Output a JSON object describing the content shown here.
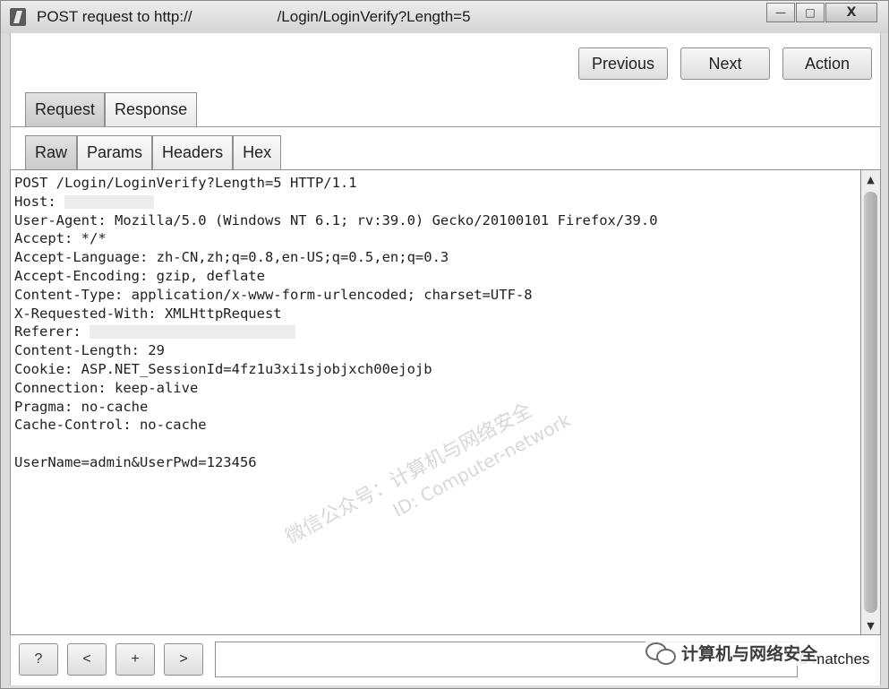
{
  "window": {
    "title_prefix": "POST request to http://",
    "title_path": "/Login/LoginVerify?Length=5",
    "minimize_glyph": "—",
    "maximize_glyph": "□",
    "close_glyph": "X"
  },
  "toolbar": {
    "previous_label": "Previous",
    "next_label": "Next",
    "action_label": "Action"
  },
  "tabs": {
    "request_label": "Request",
    "response_label": "Response"
  },
  "subtabs": {
    "raw_label": "Raw",
    "params_label": "Params",
    "headers_label": "Headers",
    "hex_label": "Hex"
  },
  "request": {
    "line1": "POST /Login/LoginVerify?Length=5 HTTP/1.1",
    "line2": "Host: ",
    "line3": "User-Agent: Mozilla/5.0 (Windows NT 6.1; rv:39.0) Gecko/20100101 Firefox/39.0",
    "line4": "Accept: */*",
    "line5": "Accept-Language: zh-CN,zh;q=0.8,en-US;q=0.5,en;q=0.3",
    "line6": "Accept-Encoding: gzip, deflate",
    "line7": "Content-Type: application/x-www-form-urlencoded; charset=UTF-8",
    "line8": "X-Requested-With: XMLHttpRequest",
    "line9": "Referer: ",
    "line10": "Content-Length: 29",
    "line11": "Cookie: ASP.NET_SessionId=4fz1u3xi1sjobjxch00ejojb",
    "line12": "Connection: keep-alive",
    "line13": "Pragma: no-cache",
    "line14": "Cache-Control: no-cache",
    "line15": "",
    "line16": "UserName=admin&UserPwd=123456"
  },
  "bottom": {
    "help_label": "?",
    "prev_label": "<",
    "add_label": "+",
    "next_label": ">",
    "search_value": "",
    "matches_label": "0 matches"
  },
  "watermark": {
    "line1": "微信公众号：计算机与网络安全",
    "line2": "ID: Computer-network",
    "badge_text": "计算机与网络安全"
  }
}
